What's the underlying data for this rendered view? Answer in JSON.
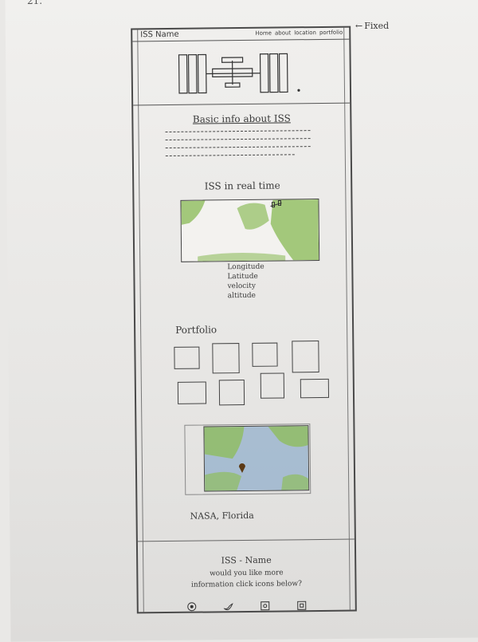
{
  "corner_note": "21.",
  "header": {
    "brand": "ISS Name",
    "nav": [
      "Home",
      "about",
      "location",
      "portfolio"
    ]
  },
  "fixed_label": "Fixed",
  "sections": {
    "basic_info_title": "Basic info about ISS",
    "real_time_title": "ISS in real time",
    "stats": [
      "Longitude",
      "Latitude",
      "velocity",
      "altitude"
    ],
    "portfolio_title": "Portfolio",
    "location_caption": "NASA, Florida"
  },
  "footer": {
    "title": "ISS - Name",
    "line1": "would you like more",
    "line2": "information click icons below?",
    "icons": [
      "instagram-icon",
      "twitter-icon",
      "github-icon",
      "linkedin-icon"
    ]
  },
  "colors": {
    "land": "#8fbd5e",
    "ocean": "#7fa4c6",
    "pin": "#5c3a14"
  }
}
